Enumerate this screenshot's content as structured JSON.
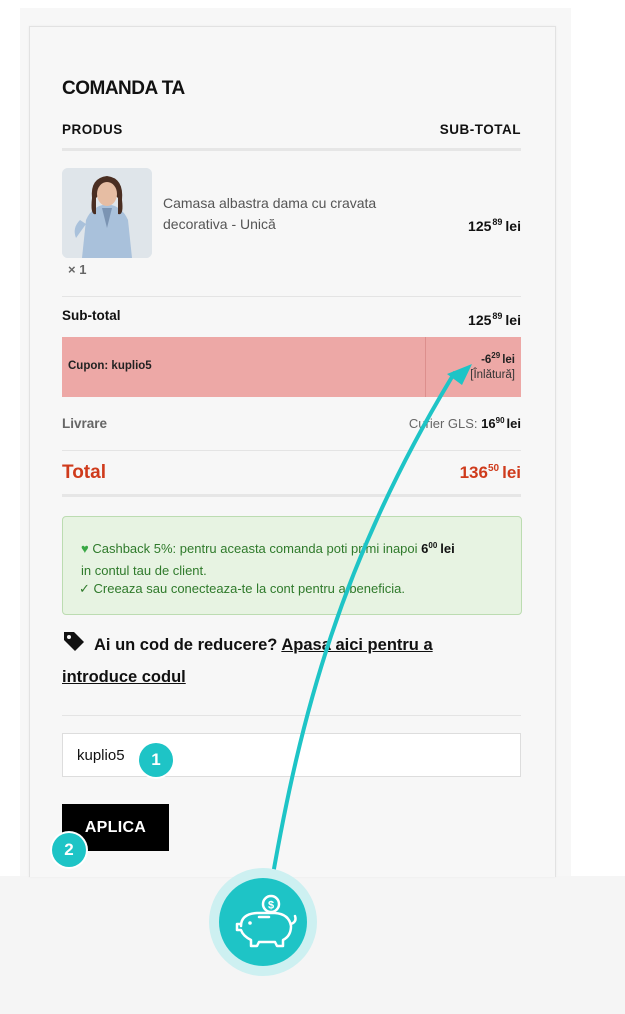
{
  "order": {
    "title": "COMANDA TA",
    "col_product": "PRODUS",
    "col_subtotal": "SUB-TOTAL"
  },
  "product": {
    "name": "Camasa albastra dama cu cravata decorativa - Unică",
    "qty": "× 1",
    "price_int": "125",
    "price_dec": "89",
    "currency": "lei"
  },
  "subtotal": {
    "label": "Sub-total",
    "int": "125",
    "dec": "89",
    "currency": "lei"
  },
  "coupon": {
    "label": "Cupon: kuplio5",
    "amount_int": "-6",
    "amount_dec": "29",
    "currency": "lei",
    "remove_label": "[Înlătură]"
  },
  "delivery": {
    "label": "Livrare",
    "carrier": "Curier GLS:",
    "int": "16",
    "dec": "90",
    "currency": "lei"
  },
  "total": {
    "label": "Total",
    "int": "136",
    "dec": "50",
    "currency": "lei"
  },
  "cashback": {
    "icon": "green-heart-icon",
    "text_before": "Cashback 5%: pentru aceasta comanda poti primi inapoi",
    "amount_int": "6",
    "amount_dec": "00",
    "currency": "lei",
    "text_after": "in contul tau de client.",
    "cta": "✓ Creeaza sau conecteaza-te la cont pentru a beneficia."
  },
  "discount": {
    "icon": "tag-icon",
    "question": "Ai un cod de reducere?",
    "link": "Apasa aici pentru a introduce codul"
  },
  "coupon_form": {
    "input_value": "kuplio5",
    "apply_label": "APLICA"
  },
  "annotations": {
    "step1": "1",
    "step2": "2",
    "accent_color": "#1ec4c6",
    "logo_icon": "piggy-bank-coin-icon"
  },
  "colors": {
    "coupon_bg": "#eda8a6",
    "total_red": "#cf3b1c",
    "cashback_green": "#2f7a2b",
    "cashback_bg": "#e7f3e2"
  }
}
